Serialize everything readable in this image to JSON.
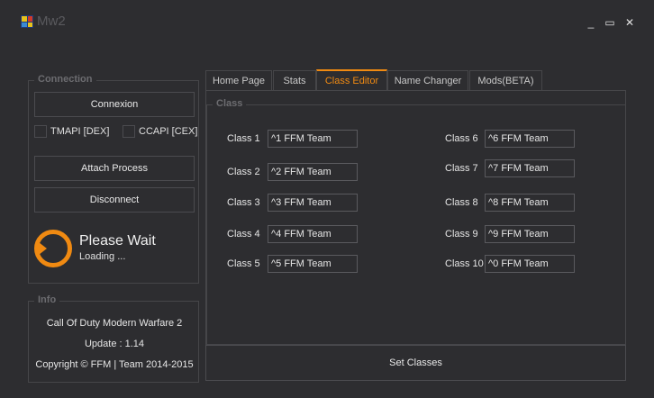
{
  "window": {
    "title": "Mw2",
    "minimize_glyph": "_",
    "maximize_glyph": "▭",
    "close_glyph": "✕"
  },
  "connection": {
    "title": "Connection",
    "connexion_label": "Connexion",
    "tmapi_label": "TMAPI [DEX]",
    "ccapi_label": "CCAPI [CEX]",
    "attach_label": "Attach Process",
    "disconnect_label": "Disconnect",
    "status_title": "Please Wait",
    "status_sub": "Loading ..."
  },
  "info": {
    "title": "Info",
    "game": "Call Of Duty Modern Warfare 2",
    "update": "Update : 1.14",
    "copyright": "Copyright © FFM | Team 2014-2015"
  },
  "tabs": [
    {
      "label": "Home Page"
    },
    {
      "label": "Stats"
    },
    {
      "label": "Class Editor",
      "active": true
    },
    {
      "label": "Name Changer"
    },
    {
      "label": "Mods(BETA)"
    }
  ],
  "class_editor": {
    "group_title": "Class",
    "classes": [
      {
        "label": "Class 1",
        "value": "^1 FFM Team"
      },
      {
        "label": "Class 2",
        "value": "^2 FFM Team"
      },
      {
        "label": "Class 3",
        "value": "^3 FFM Team"
      },
      {
        "label": "Class 4",
        "value": "^4 FFM Team"
      },
      {
        "label": "Class 5",
        "value": "^5 FFM Team"
      },
      {
        "label": "Class 6",
        "value": "^6 FFM Team"
      },
      {
        "label": "Class 7",
        "value": "^7 FFM Team"
      },
      {
        "label": "Class 8",
        "value": "^8 FFM Team"
      },
      {
        "label": "Class 9",
        "value": "^9 FFM Team"
      },
      {
        "label": "Class 10",
        "value": "^0 FFM Team"
      }
    ],
    "set_label": "Set Classes"
  },
  "colors": {
    "accent": "#f08a12",
    "background": "#2d2d30",
    "border": "#464649"
  }
}
